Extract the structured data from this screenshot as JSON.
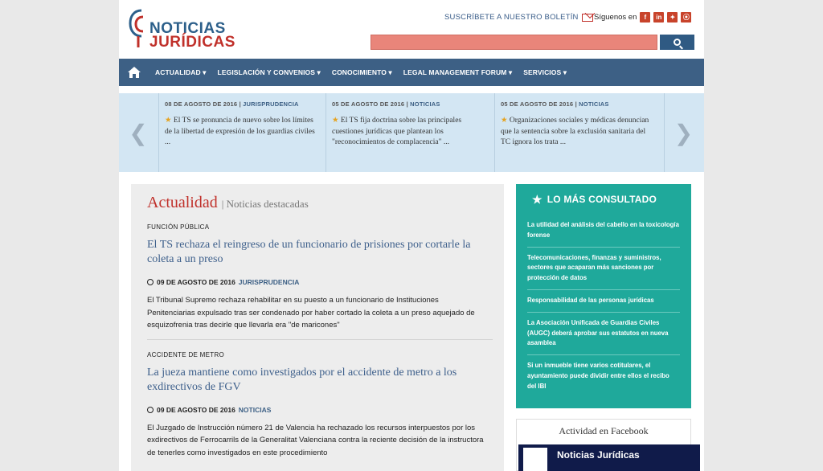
{
  "header": {
    "logo_line1": "NOTICIAS",
    "logo_line2": "JURÍDICAS",
    "subscribe_label": "SUSCRÍBETE A NUESTRO BOLETÍN",
    "follow_label": "Síguenos en",
    "social": [
      "f",
      "in",
      "t",
      "rss"
    ],
    "search_placeholder": ""
  },
  "nav": {
    "items": [
      "ACTUALIDAD ▾",
      "LEGISLACIÓN Y CONVENIOS ▾",
      "CONOCIMIENTO ▾",
      "LEGAL MANAGEMENT FORUM ▾",
      "SERVICIOS ▾"
    ]
  },
  "ticker": [
    {
      "date": "08 DE AGOSTO DE 2016",
      "cat": "JURISPRUDENCIA",
      "text": "El TS se pronuncia de nuevo sobre los límites de la libertad de expresión de los guardias civiles ..."
    },
    {
      "date": "05 DE AGOSTO DE 2016",
      "cat": "NOTICIAS",
      "text": "El TS fija doctrina sobre las principales cuestiones jurídicas que plantean los \"reconocimientos de complacencia\" ..."
    },
    {
      "date": "05 DE AGOSTO DE 2016",
      "cat": "NOTICIAS",
      "text": "Organizaciones sociales y médicas denuncian que la sentencia sobre la exclusión sanitaria del TC ignora los trata ..."
    }
  ],
  "main": {
    "title": "Actualidad",
    "subtitle": "| Noticias destacadas",
    "articles": [
      {
        "category": "FUNCIÓN PÚBLICA",
        "title": "El TS rechaza el reingreso de un funcionario de prisiones por cortarle la coleta a un preso",
        "date": "09 DE AGOSTO DE 2016",
        "cat": "JURISPRUDENCIA",
        "text": "El Tribunal Supremo rechaza rehabilitar en su puesto a un funcionario de Instituciones Penitenciarias expulsado tras ser condenado por haber cortado la coleta a un preso aquejado de esquizofrenia tras decirle que llevarla era \"de maricones\""
      },
      {
        "category": "ACCIDENTE DE METRO",
        "title": "La jueza mantiene como investigados por el accidente de metro a los exdirectivos de FGV",
        "date": "09 DE AGOSTO DE 2016",
        "cat": "NOTICIAS",
        "text": "El Juzgado de Instrucción número 21 de Valencia ha rechazado los recursos interpuestos por los exdirectivos de Ferrocarrils de la Generalitat Valenciana contra la reciente decisión de la instructora de tenerles como investigados en este procedimiento"
      }
    ]
  },
  "sidebar": {
    "title": "LO MÁS CONSULTADO",
    "items": [
      "La utilidad del análisis del cabello en la toxicología forense",
      "Telecomunicaciones, finanzas y suministros, sectores que acaparan más sanciones por protección de datos",
      "Responsabilidad de las personas jurídicas",
      "La Asociación Unificada de Guardias Civiles (AUGC) deberá aprobar sus estatutos en nueva asamblea",
      "Si un inmueble tiene varios cotitulares, el ayuntamiento puede dividir entre ellos el recibo del IBI"
    ]
  },
  "facebook": {
    "title": "Actividad en Facebook",
    "page_name": "Noticias Jurídicas"
  }
}
